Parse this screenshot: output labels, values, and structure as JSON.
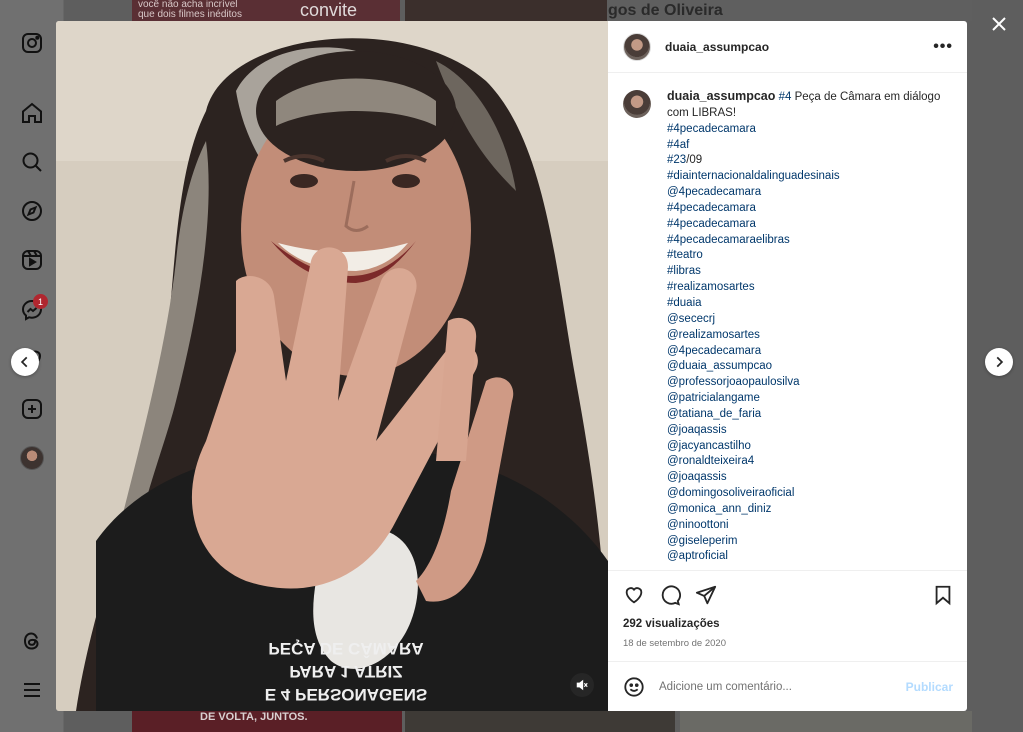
{
  "background": {
    "tile1_lines": [
      "você não acha incrível",
      "que dois filmes inéditos"
    ],
    "tile1_word": "convite",
    "tile3_text": "gos de Oliveira",
    "tile4_text": "DE VOLTA, JUNTOS."
  },
  "nav": {
    "badge_count": "1",
    "icons": [
      "instagram-icon",
      "home-icon",
      "search-icon",
      "explore-icon",
      "reels-icon",
      "messenger-icon",
      "notifications-icon",
      "create-icon",
      "profile-avatar",
      "threads-icon",
      "menu-icon"
    ]
  },
  "post": {
    "username": "duaia_assumpcao",
    "shirt_text": [
      "PEÇA DE CÂMARA",
      "PARA 1 ATRIZ",
      "E 4 PERSONAGENS"
    ],
    "caption": {
      "user": "duaia_assumpcao",
      "lead_tag": "#4",
      "lead_text": " Peça de Câmara em diálogo com LIBRAS!",
      "date_tag": "#23",
      "date_rest": "/09",
      "tags_before": [
        "#4pecadecamara",
        "#4af"
      ],
      "tags_after": [
        "#diainternacionaldalinguadesinais",
        "@4pecadecamara",
        "#4pecadecamara",
        "#4pecadecamara",
        "#4pecadecamaraelibras",
        "#teatro",
        "#libras",
        "#realizamosartes",
        "#duaia",
        "@sececrj",
        "@realizamosartes",
        "@4pecadecamara",
        "@duaia_assumpcao",
        "@professorjoaopaulosilva",
        "@patricialangame",
        "@tatiana_de_faria",
        "@joaqassis",
        "@jacyancastilho",
        "@ronaldteixeira4",
        "@joaqassis",
        "@domingosoliveiraoficial",
        "@monica_ann_diniz",
        "@ninoottoni",
        "@giseleperim",
        "@aptroficial"
      ]
    },
    "views": "292 visualizações",
    "date": "18 de setembro de 2020",
    "comment_placeholder": "Adicione um comentário...",
    "post_button": "Publicar"
  },
  "colors": {
    "link": "#00376b",
    "post_button": "#b3dbff",
    "badge": "#b0262f"
  }
}
